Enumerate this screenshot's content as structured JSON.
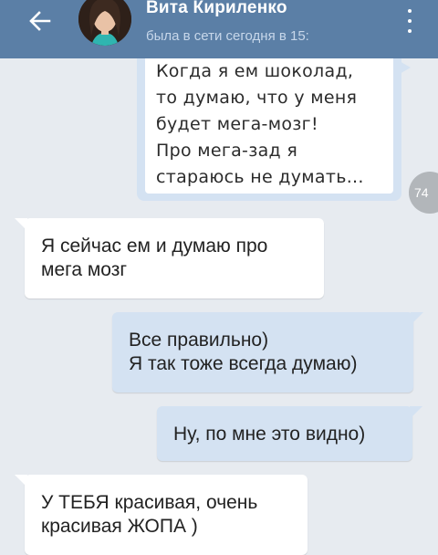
{
  "header": {
    "contact_name": "Вита Кириленко",
    "status": "была в сети сегодня в 15:"
  },
  "messages": [
    {
      "direction": "outgoing",
      "type": "image",
      "image_text": "Когда я ем шоколад,\nто думаю, что у меня\nбудет мега-мозг!\nПро мега-зад я\nстараюсь не думать...",
      "badge": "74"
    },
    {
      "direction": "incoming",
      "text": "Я сейчас ем и думаю про\nмега мозг"
    },
    {
      "direction": "outgoing",
      "text": "Все правильно)\nЯ так тоже всегда думаю)"
    },
    {
      "direction": "outgoing",
      "text": "Ну, по мне это видно)"
    },
    {
      "direction": "incoming",
      "text": "У ТЕБЯ красивая, очень\nкрасивая ЖОПА )"
    }
  ],
  "colors": {
    "header_bg": "#5b7fa6",
    "chat_bg": "#e7ebf0",
    "outgoing_bubble": "#d4e2f2",
    "incoming_bubble": "#ffffff"
  },
  "icons": {
    "back": "arrow-left-icon",
    "menu": "more-vert-icon"
  }
}
